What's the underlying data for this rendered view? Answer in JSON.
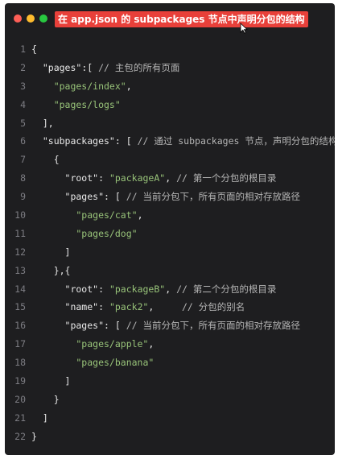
{
  "colors": {
    "window_bg": "#1e1e20",
    "dot_red": "#fe5f57",
    "dot_yellow": "#febc2e",
    "dot_green": "#28c840",
    "title_bg": "#e8403a",
    "title_text": "#ffffff",
    "string": "#98c379",
    "comment": "#b5b5b5",
    "line_number": "#7c7c82"
  },
  "window": {
    "title": "在 app.json 的 subpackages 节点中声明分包的结构"
  },
  "icons": {
    "cursor": "arrow-cursor-icon"
  },
  "code": {
    "lines": [
      {
        "n": "1",
        "tokens": [
          {
            "t": "{",
            "k": "punct"
          }
        ]
      },
      {
        "n": "2",
        "tokens": [
          {
            "t": "  \"pages\"",
            "k": "key"
          },
          {
            "t": ":[ ",
            "k": "punct"
          },
          {
            "t": "// 主包的所有页面",
            "k": "comment"
          }
        ]
      },
      {
        "n": "3",
        "tokens": [
          {
            "t": "    \"pages/index\"",
            "k": "str"
          },
          {
            "t": ",",
            "k": "punct"
          }
        ]
      },
      {
        "n": "4",
        "tokens": [
          {
            "t": "    \"pages/logs\"",
            "k": "str"
          }
        ]
      },
      {
        "n": "5",
        "tokens": [
          {
            "t": "  ],",
            "k": "punct"
          }
        ]
      },
      {
        "n": "6",
        "tokens": [
          {
            "t": "  \"subpackages\"",
            "k": "key"
          },
          {
            "t": ": [ ",
            "k": "punct"
          },
          {
            "t": "// 通过 subpackages 节点，声明分包的结构",
            "k": "comment"
          }
        ]
      },
      {
        "n": "7",
        "tokens": [
          {
            "t": "    {",
            "k": "punct"
          }
        ]
      },
      {
        "n": "8",
        "tokens": [
          {
            "t": "      \"root\"",
            "k": "key"
          },
          {
            "t": ": ",
            "k": "punct"
          },
          {
            "t": "\"packageA\"",
            "k": "str"
          },
          {
            "t": ", ",
            "k": "punct"
          },
          {
            "t": "// 第一个分包的根目录",
            "k": "comment"
          }
        ]
      },
      {
        "n": "9",
        "tokens": [
          {
            "t": "      \"pages\"",
            "k": "key"
          },
          {
            "t": ": [ ",
            "k": "punct"
          },
          {
            "t": "// 当前分包下，所有页面的相对存放路径",
            "k": "comment"
          }
        ]
      },
      {
        "n": "10",
        "tokens": [
          {
            "t": "        \"pages/cat\"",
            "k": "str"
          },
          {
            "t": ",",
            "k": "punct"
          }
        ]
      },
      {
        "n": "11",
        "tokens": [
          {
            "t": "        \"pages/dog\"",
            "k": "str"
          }
        ]
      },
      {
        "n": "12",
        "tokens": [
          {
            "t": "      ]",
            "k": "punct"
          }
        ]
      },
      {
        "n": "13",
        "tokens": [
          {
            "t": "    },{",
            "k": "punct"
          }
        ]
      },
      {
        "n": "14",
        "tokens": [
          {
            "t": "      \"root\"",
            "k": "key"
          },
          {
            "t": ": ",
            "k": "punct"
          },
          {
            "t": "\"packageB\"",
            "k": "str"
          },
          {
            "t": ", ",
            "k": "punct"
          },
          {
            "t": "// 第二个分包的根目录",
            "k": "comment"
          }
        ]
      },
      {
        "n": "15",
        "tokens": [
          {
            "t": "      \"name\"",
            "k": "key"
          },
          {
            "t": ": ",
            "k": "punct"
          },
          {
            "t": "\"pack2\"",
            "k": "str"
          },
          {
            "t": ",     ",
            "k": "punct"
          },
          {
            "t": "// 分包的别名",
            "k": "comment"
          }
        ]
      },
      {
        "n": "16",
        "tokens": [
          {
            "t": "      \"pages\"",
            "k": "key"
          },
          {
            "t": ": [ ",
            "k": "punct"
          },
          {
            "t": "// 当前分包下，所有页面的相对存放路径",
            "k": "comment"
          }
        ]
      },
      {
        "n": "17",
        "tokens": [
          {
            "t": "        \"pages/apple\"",
            "k": "str"
          },
          {
            "t": ",",
            "k": "punct"
          }
        ]
      },
      {
        "n": "18",
        "tokens": [
          {
            "t": "        \"pages/banana\"",
            "k": "str"
          }
        ]
      },
      {
        "n": "19",
        "tokens": [
          {
            "t": "      ]",
            "k": "punct"
          }
        ]
      },
      {
        "n": "20",
        "tokens": [
          {
            "t": "    }",
            "k": "punct"
          }
        ]
      },
      {
        "n": "21",
        "tokens": [
          {
            "t": "  ]",
            "k": "punct"
          }
        ]
      },
      {
        "n": "22",
        "tokens": [
          {
            "t": "}",
            "k": "punct"
          }
        ]
      }
    ]
  }
}
